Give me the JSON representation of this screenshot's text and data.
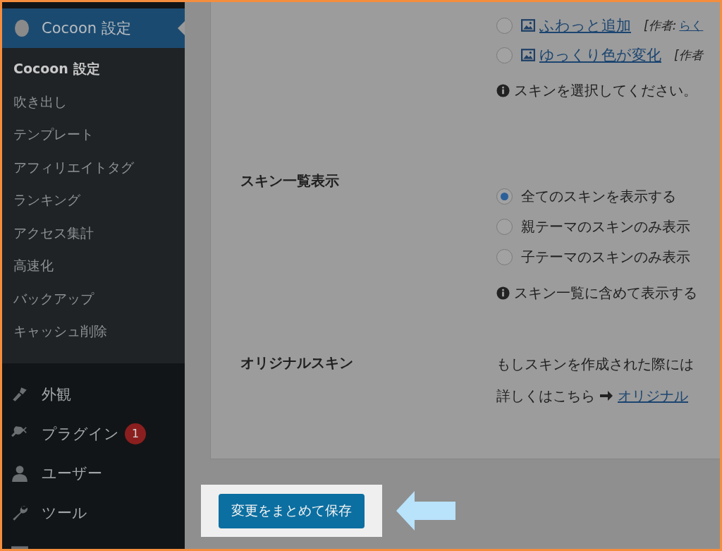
{
  "sidebar": {
    "header": {
      "label": "Cocoon 設定"
    },
    "submenu": [
      {
        "label": "Cocoon 設定",
        "selected": true
      },
      {
        "label": "吹き出し",
        "selected": false
      },
      {
        "label": "テンプレート",
        "selected": false
      },
      {
        "label": "アフィリエイトタグ",
        "selected": false
      },
      {
        "label": "ランキング",
        "selected": false
      },
      {
        "label": "アクセス集計",
        "selected": false
      },
      {
        "label": "高速化",
        "selected": false
      },
      {
        "label": "バックアップ",
        "selected": false
      },
      {
        "label": "キャッシュ削除",
        "selected": false
      }
    ],
    "menu": [
      {
        "kind": "brush",
        "label": "外観"
      },
      {
        "kind": "plug",
        "label": "プラグイン",
        "badge": "1"
      },
      {
        "kind": "user",
        "label": "ユーザー"
      },
      {
        "kind": "wrench",
        "label": "ツール"
      },
      {
        "kind": "settings"
      }
    ]
  },
  "skins": [
    {
      "name": "ふわっと追加",
      "selected": false,
      "author_label": "[作者:",
      "author": "らく"
    },
    {
      "name": "ゆっくり色が変化",
      "selected": false,
      "author_label": "[作者"
    }
  ],
  "skin_note": "スキンを選択してください。",
  "skin_list": {
    "label": "スキン一覧表示",
    "options": [
      {
        "label": "全てのスキンを表示する",
        "selected": true
      },
      {
        "label": "親テーマのスキンのみ表示",
        "selected": false
      },
      {
        "label": "子テーマのスキンのみ表示",
        "selected": false
      }
    ],
    "note": "スキン一覧に含めて表示する"
  },
  "original_skin": {
    "label": "オリジナルスキン",
    "text": "もしスキンを作成された際には",
    "more": "詳しくはこちら",
    "link": "オリジナル"
  },
  "save_button": "変更をまとめて保存"
}
